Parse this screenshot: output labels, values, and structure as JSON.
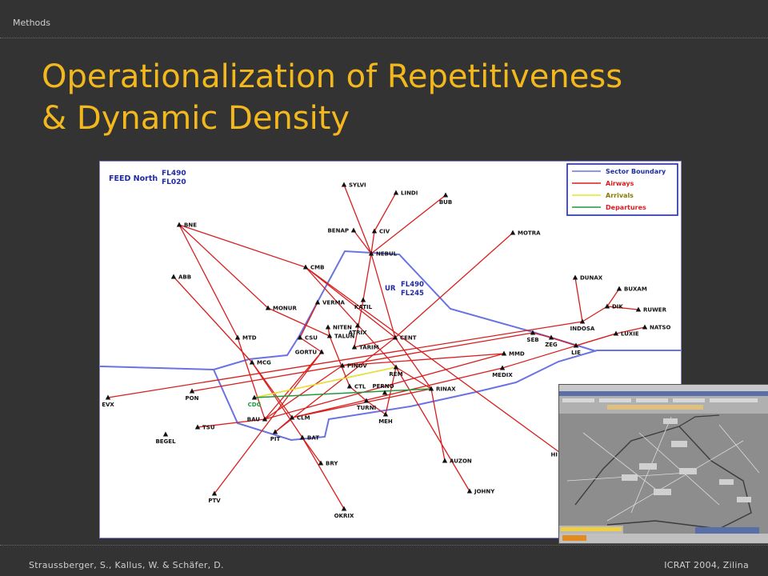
{
  "header": {
    "section": "Methods"
  },
  "title": {
    "line1": "Operationalization of Repetitiveness",
    "line2": "& Dynamic Density"
  },
  "footer": {
    "authors": "Straussberger, S., Kallus, W. & Schäfer, D.",
    "venue": "ICRAT  2004, Zilina"
  },
  "map": {
    "sector_name": "FEED North",
    "sector_fl_top": "FL490",
    "sector_fl_bottom": "FL020",
    "ur_label": "UR",
    "ur_fl_top": "FL490",
    "ur_fl_bottom": "FL245",
    "legend": {
      "boundary": "Sector Boundary",
      "airways": "Airways",
      "arrivals": "Arrivals",
      "departures": "Departures"
    },
    "colors": {
      "boundary": "#6b73e0",
      "airways": "#d81e1e",
      "arrivals": "#e6e62a",
      "departures": "#1f9a3a",
      "navy": "#1f2aa5"
    },
    "waypoints": {
      "SYLVI": "SYLVI",
      "LINDI": "LINDI",
      "BUB": "BUB",
      "BENAP": "BENAP",
      "CIV": "CIV",
      "NEBUL": "NEBUL",
      "MOTRA": "MOTRA",
      "BNE": "BNE",
      "CMB": "CMB",
      "ABB": "ABB",
      "MONUR": "MONUR",
      "VERMA": "VERMA",
      "KATIL": "KATIL",
      "DUNAX": "DUNAX",
      "BUXAM": "BUXAM",
      "RUWER": "RUWER",
      "DIK": "DIK",
      "INDOSA": "INDOSA",
      "NATSO": "NATSO",
      "LUXIE": "LUXIE",
      "SEB": "SEB",
      "ZEG": "ZEG",
      "LIE": "LIE",
      "NITEN": "NITEN",
      "ATRIX": "ATRIX",
      "TALUN": "TALUN",
      "CSU": "CSU",
      "MTD": "MTD",
      "CENT": "CENT",
      "GORTU": "GORTU",
      "TARIM": "TARIM",
      "MCG": "MCG",
      "PINOV": "PINOV",
      "MMD": "MMD",
      "MEDIX": "MEDIX",
      "REM": "REM",
      "CTL": "CTL",
      "PERNO": "PERNO",
      "RINAX": "RINAX",
      "EVX": "EVX",
      "PON": "PON",
      "CDG": "CDG",
      "TURNI": "TURNI",
      "BAU": "BAU",
      "CLM": "CLM",
      "MEH": "MEH",
      "TSU": "TSU",
      "BEGEL": "BEGEL",
      "PIT": "PIT",
      "BAT": "BAT",
      "AUZON": "AUZON",
      "HI": "HI",
      "BRY": "BRY",
      "JOHNY": "JOHNY",
      "PTV": "PTV",
      "OKRIX": "OKRIX"
    }
  }
}
